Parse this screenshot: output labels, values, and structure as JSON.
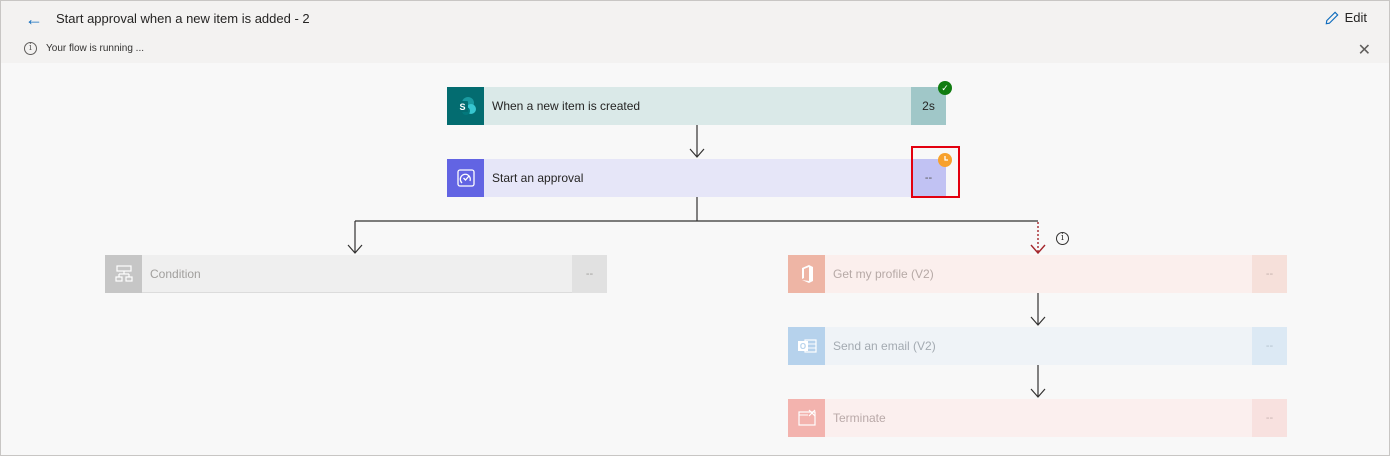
{
  "header": {
    "back_label": "←",
    "title": "Start approval when a new item is added - 2",
    "edit_label": "Edit"
  },
  "banner": {
    "info_glyph": "i",
    "text": "Your flow is running ...",
    "close_glyph": "✕"
  },
  "steps": {
    "trigger": {
      "label": "When a new item is created",
      "duration": "2s",
      "state": "succeeded",
      "icon": "sharepoint-icon",
      "color": "#036c70"
    },
    "approval": {
      "label": "Start an approval",
      "duration": "--",
      "state": "running",
      "icon": "approval-icon",
      "color": "#6264e3"
    },
    "condition": {
      "label": "Condition",
      "duration": "--",
      "state": "not-run",
      "icon": "condition-icon"
    },
    "profile": {
      "label": "Get my profile (V2)",
      "duration": "--",
      "state": "not-run",
      "icon": "office-icon"
    },
    "email": {
      "label": "Send an email (V2)",
      "duration": "--",
      "state": "not-run",
      "icon": "outlook-icon"
    },
    "terminate": {
      "label": "Terminate",
      "duration": "--",
      "state": "not-run",
      "icon": "terminate-icon"
    }
  },
  "badges": {
    "success_glyph": "✓"
  },
  "connector_info_glyph": "i",
  "colors": {
    "accent": "#0f6cbd",
    "success": "#107c10",
    "pending": "#f7a12d",
    "highlight": "#e3000f"
  }
}
